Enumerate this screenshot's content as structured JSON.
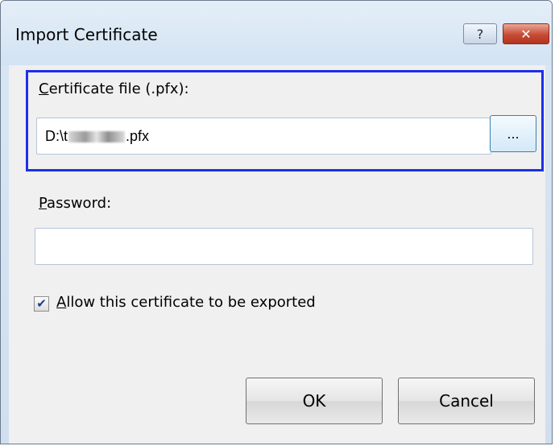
{
  "window": {
    "title": "Import Certificate",
    "help_glyph": "?",
    "close_glyph": "✕"
  },
  "certificate": {
    "label_access": "C",
    "label_rest": "ertificate file (.pfx):",
    "path_prefix": "D:\\t",
    "path_suffix": ".pfx",
    "browse_label": "..."
  },
  "password": {
    "label_access": "P",
    "label_rest": "assword:",
    "value": ""
  },
  "export": {
    "checked": true,
    "check_glyph": "✔",
    "label_access": "A",
    "label_rest": "llow this certificate to be exported"
  },
  "buttons": {
    "ok": "OK",
    "cancel": "Cancel"
  },
  "colors": {
    "highlight_border": "#1f2fe8",
    "close_button": "#c74b34"
  },
  "icons": [
    "help-icon",
    "close-icon",
    "checkmark-icon"
  ]
}
